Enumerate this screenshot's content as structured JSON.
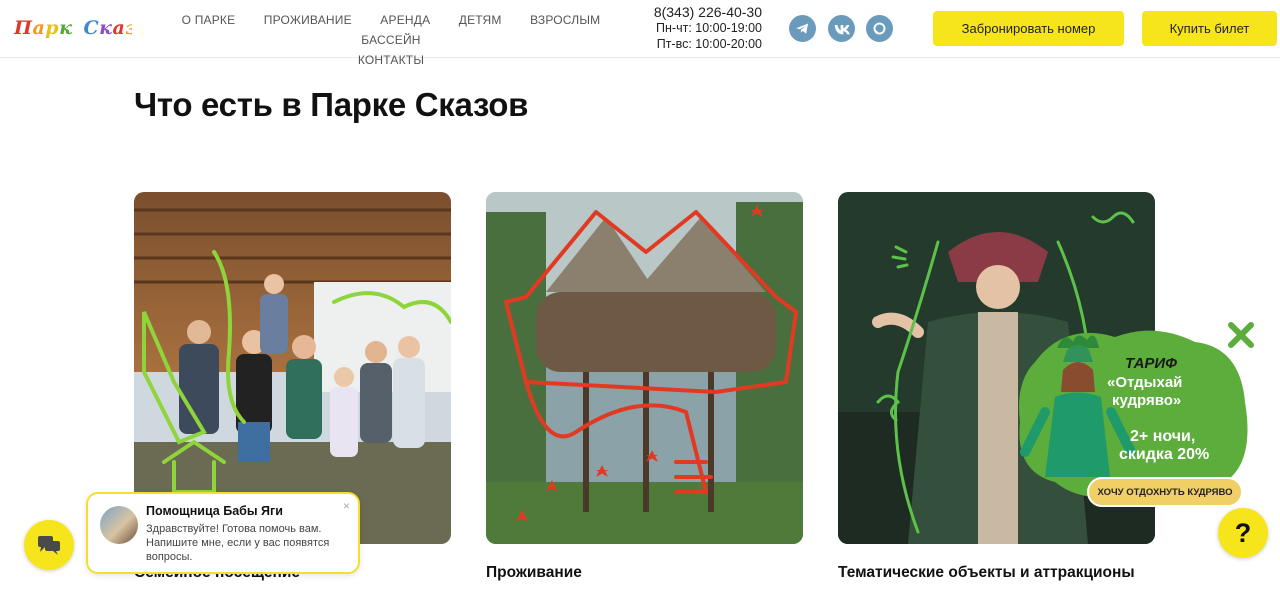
{
  "header": {
    "logo": "Парк Сказов",
    "nav": [
      "О ПАРКЕ",
      "ПРОЖИВАНИЕ",
      "АРЕНДА",
      "ДЕТЯМ",
      "ВЗРОСЛЫМ",
      "БАССЕЙН",
      "КОНТАКТЫ"
    ],
    "phone": "8(343) 226-40-30",
    "hours_weekday": "Пн-чт: 10:00-19:00",
    "hours_weekend": "Пт-вс: 10:00-20:00",
    "social": [
      "telegram-icon",
      "vk-icon",
      "chat-icon"
    ],
    "book_room_label": "Забронировать номер",
    "buy_ticket_label": "Купить билет"
  },
  "main": {
    "title": "Что есть в Парке Сказов",
    "cards": [
      {
        "caption": "Семейное посещение"
      },
      {
        "caption": "Проживание"
      },
      {
        "caption": "Тематические объекты и аттракционы"
      }
    ]
  },
  "promo": {
    "tariff": "ТАРИФ",
    "tariff_name_line1": "«Отдыхай",
    "tariff_name_line2": "кудряво»",
    "offer_line1": "2+ ночи,",
    "offer_line2": "скидка 20%",
    "cta": "ХОЧУ ОТДОХНУТЬ КУДРЯВО"
  },
  "chat": {
    "name": "Помощница Бабы Яги",
    "message": "Здравствуйте! Готова помочь вам. Напишите мне, если у вас появятся вопросы.",
    "close": "×"
  },
  "help": {
    "label": "?"
  },
  "colors": {
    "accent_yellow": "#f7e51b",
    "promo_green": "#5cad3c",
    "social_blue": "#6a9bbd"
  }
}
